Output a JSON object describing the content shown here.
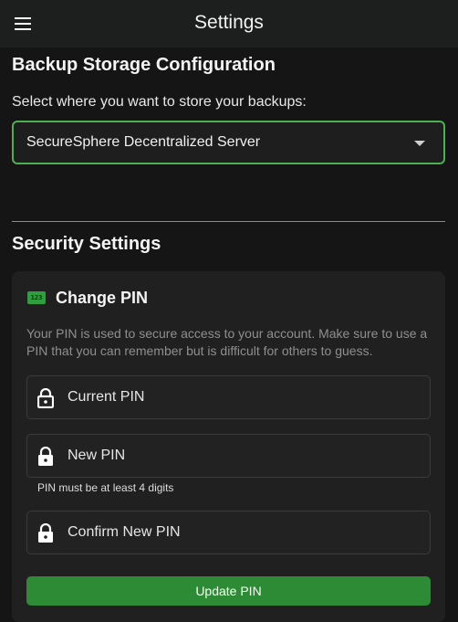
{
  "appbar": {
    "title": "Settings",
    "menu_icon": "menu-icon"
  },
  "backup": {
    "title": "Backup Storage Configuration",
    "select_label": "Select where you want to store your backups:",
    "selected_value": "SecureSphere Decentralized Server"
  },
  "security": {
    "title": "Security Settings",
    "change_pin": {
      "badge_icon": "pin-123-icon",
      "badge_text": "123",
      "title": "Change PIN",
      "description": "Your PIN is used to secure access to your account. Make sure to use a PIN that you can remember but is difficult for others to guess.",
      "fields": [
        {
          "label": "Current PIN",
          "icon": "lock-icon"
        },
        {
          "label": "New PIN",
          "icon": "lock-icon"
        },
        {
          "label": "Confirm New PIN",
          "icon": "lock-icon"
        }
      ],
      "new_pin_hint": "PIN must be at least 4 digits",
      "update_button": "Update PIN"
    }
  },
  "colors": {
    "accent": "#4caf50",
    "button": "#2e8b35",
    "background": "#151515",
    "card": "#202020"
  }
}
